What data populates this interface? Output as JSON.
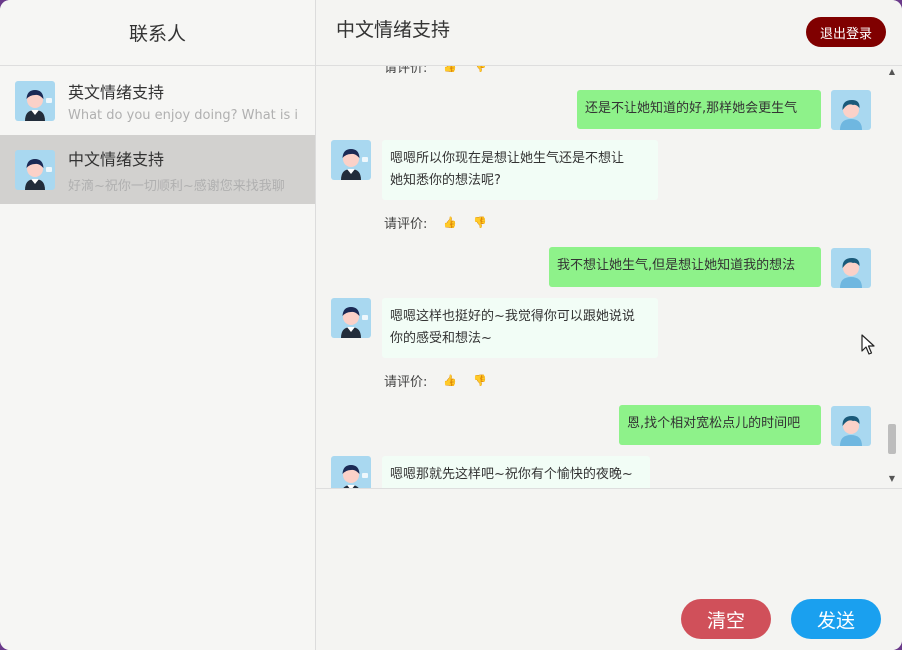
{
  "sidebar": {
    "title": "联系人",
    "contacts": [
      {
        "name": "英文情绪支持",
        "preview": "What do you enjoy doing? What is it"
      },
      {
        "name": "中文情绪支持",
        "preview": "好滴~祝你一切顺利~感谢您来找我聊"
      }
    ]
  },
  "header": {
    "title": "中文情绪支持",
    "logout_label": "退出登录"
  },
  "messages": {
    "top_partial": "请评价:",
    "items": [
      {
        "role": "user",
        "text": "还是不让她知道的好,那样她会更生气"
      },
      {
        "role": "bot",
        "text": "嗯嗯所以你现在是想让她生气还是不想让她知悉你的想法呢?",
        "line1": "嗯嗯所以你现在是想让她生气还是不想让",
        "line2": "她知悉你的想法呢?"
      },
      {
        "role": "rate",
        "text": "请评价:"
      },
      {
        "role": "user",
        "text": "我不想让她生气,但是想让她知道我的想法"
      },
      {
        "role": "bot",
        "text": "嗯嗯这样也挺好的~我觉得你可以跟她说说你的感受和想法~",
        "line1": "嗯嗯这样也挺好的~我觉得你可以跟她说说",
        "line2": "你的感受和想法~"
      },
      {
        "role": "rate",
        "text": "请评价:"
      },
      {
        "role": "user",
        "text": "恩,找个相对宽松点儿的时间吧"
      },
      {
        "role": "bot",
        "text": "嗯嗯那就先这样吧~祝你有个愉快的夜晚~"
      }
    ]
  },
  "input": {
    "value": "",
    "clear_label": "清空",
    "send_label": "发送"
  },
  "icons": {
    "thumb_up": "thumbs-up-icon",
    "thumb_down": "thumbs-down-icon",
    "user_avatar": "user-avatar",
    "bot_avatar": "bot-avatar"
  },
  "colors": {
    "user_bubble": "#8ef28a",
    "bot_bubble": "#f2fdf6",
    "logout": "#800000",
    "clear": "#d0505a",
    "send": "#1aa0ef"
  }
}
